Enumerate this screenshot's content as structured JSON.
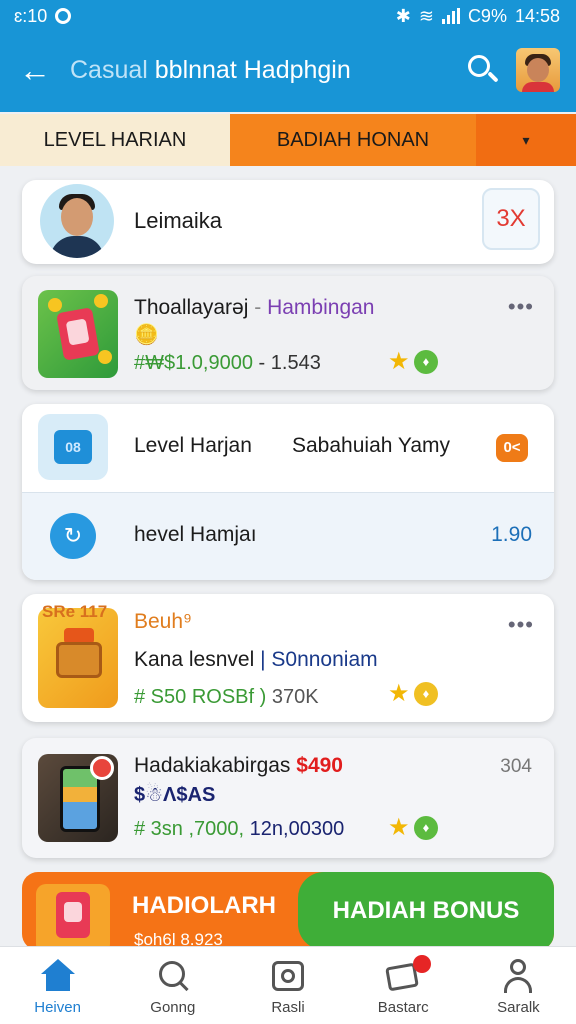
{
  "status_bar": {
    "time_left": "ɛ:10",
    "battery": "C9%",
    "time_right": "14:58"
  },
  "header": {
    "title_light": "Casual ",
    "title_main": "bblnnat Hadphgin"
  },
  "tabs": {
    "tab1": "LEVEL HARIAN",
    "tab2": "BADIAH HONAN",
    "tab3_icon": "▾"
  },
  "profile_card": {
    "name": "Leimaika",
    "badge": "3X"
  },
  "card_game": {
    "title_a": "Thoallayarəj",
    "title_sep": " - ",
    "title_b": "Hambingan",
    "price": "#₩$1.0,9000",
    "price_tail": "- 1.543",
    "more": "•••"
  },
  "level_card": {
    "row1_label": "Level Harjan",
    "row1_label2": "Sabahuiah Yamy",
    "row1_chip": "0<",
    "row2_label": "hevel Hamjaı",
    "row2_value": "1.90"
  },
  "card_bonus": {
    "tag": "SRe   117",
    "title": "Beuh⁹",
    "line2_a": "Kana lesnvel ",
    "line2_b": "| S0nnoniam",
    "price": "# S50 ROSBf )",
    "price_tail": " 370K",
    "more": "•••"
  },
  "card_phone": {
    "title": "Hadakiakabirgas ",
    "title_price": "$490",
    "count": "304",
    "sub": "$☃Ʌ$AS",
    "price": "# 3sn ,7000,",
    "price_tail": " 12n,00300"
  },
  "banner": {
    "left_text": "HADIOLARH",
    "right_text": "HADIAH BONUS",
    "under": "$oh6l 8.923"
  },
  "bottom_nav": [
    {
      "label": "Heiven"
    },
    {
      "label": "Gonng"
    },
    {
      "label": "Rasli"
    },
    {
      "label": "Bastarc"
    },
    {
      "label": "Saralk"
    }
  ]
}
